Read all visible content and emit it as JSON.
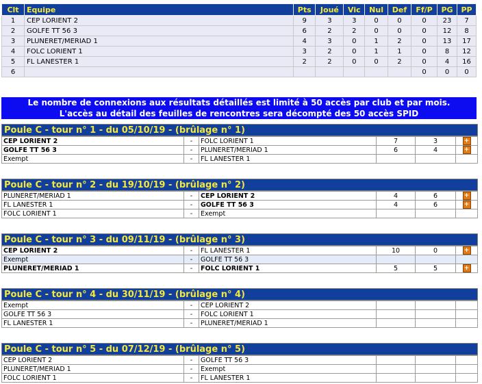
{
  "standings": {
    "headers": [
      "Clt",
      "Equipe",
      "Pts",
      "Joué",
      "Vic",
      "Nul",
      "Def",
      "Ff/P",
      "PG",
      "PP"
    ],
    "rows": [
      [
        "1",
        "CEP LORIENT 2",
        "9",
        "3",
        "3",
        "0",
        "0",
        "0",
        "23",
        "7"
      ],
      [
        "2",
        "GOLFE TT 56 3",
        "6",
        "2",
        "2",
        "0",
        "0",
        "0",
        "12",
        "8"
      ],
      [
        "3",
        "PLUNERET/MERIAD 1",
        "4",
        "3",
        "0",
        "1",
        "2",
        "0",
        "13",
        "17"
      ],
      [
        "4",
        "FOLC LORIENT 1",
        "3",
        "2",
        "0",
        "1",
        "1",
        "0",
        "8",
        "12"
      ],
      [
        "5",
        "FL LANESTER 1",
        "2",
        "2",
        "0",
        "0",
        "2",
        "0",
        "4",
        "16"
      ],
      [
        "6",
        "",
        "",
        "",
        "",
        "",
        "",
        "0",
        "0",
        "0"
      ]
    ]
  },
  "notice": {
    "line1": "Le nombre de connexions aux résultats détaillés est limité à 50 accès par club et par mois.",
    "line2": "L'accès au détail des feuilles de rencontres sera décompté des 50 accès SPID"
  },
  "rounds": [
    {
      "title": "Poule C - tour n° 1 - du 05/10/19 - (brûlage n° 1)",
      "matches": [
        {
          "a": "CEP LORIENT 2",
          "a_bold": true,
          "sep": "-",
          "b": "FOLC LORIENT 1",
          "b_bold": false,
          "sa": "7",
          "sb": "3",
          "detail": true,
          "hl": false
        },
        {
          "a": "GOLFE TT 56 3",
          "a_bold": true,
          "sep": "-",
          "b": "PLUNERET/MERIAD 1",
          "b_bold": false,
          "sa": "6",
          "sb": "4",
          "detail": true,
          "hl": false
        },
        {
          "a": "Exempt",
          "a_bold": false,
          "sep": "-",
          "b": "FL LANESTER 1",
          "b_bold": false,
          "sa": "",
          "sb": "",
          "detail": false,
          "hl": false
        }
      ]
    },
    {
      "title": "Poule C - tour n° 2 - du 19/10/19 - (brûlage n° 2)",
      "matches": [
        {
          "a": "PLUNERET/MERIAD 1",
          "a_bold": false,
          "sep": "-",
          "b": "CEP LORIENT 2",
          "b_bold": true,
          "sa": "4",
          "sb": "6",
          "detail": true,
          "hl": false
        },
        {
          "a": "FL LANESTER 1",
          "a_bold": false,
          "sep": "-",
          "b": "GOLFE TT 56 3",
          "b_bold": true,
          "sa": "4",
          "sb": "6",
          "detail": true,
          "hl": false
        },
        {
          "a": "FOLC LORIENT 1",
          "a_bold": false,
          "sep": "-",
          "b": "Exempt",
          "b_bold": false,
          "sa": "",
          "sb": "",
          "detail": false,
          "hl": false
        }
      ]
    },
    {
      "title": "Poule C - tour n° 3 - du 09/11/19 - (brûlage n° 3)",
      "matches": [
        {
          "a": "CEP LORIENT 2",
          "a_bold": true,
          "sep": "-",
          "b": "FL LANESTER 1",
          "b_bold": false,
          "sa": "10",
          "sb": "0",
          "detail": true,
          "hl": false
        },
        {
          "a": "Exempt",
          "a_bold": false,
          "sep": "-",
          "b": "GOLFE TT 56 3",
          "b_bold": false,
          "sa": "",
          "sb": "",
          "detail": false,
          "hl": true
        },
        {
          "a": "PLUNERET/MERIAD 1",
          "a_bold": true,
          "sep": "-",
          "b": "FOLC LORIENT 1",
          "b_bold": true,
          "sa": "5",
          "sb": "5",
          "detail": true,
          "hl": false
        }
      ]
    },
    {
      "title": "Poule C - tour n° 4 - du 30/11/19 - (brûlage n° 4)",
      "matches": [
        {
          "a": "Exempt",
          "a_bold": false,
          "sep": "-",
          "b": "CEP LORIENT 2",
          "b_bold": false,
          "sa": "",
          "sb": "",
          "detail": false,
          "hl": false
        },
        {
          "a": "GOLFE TT 56 3",
          "a_bold": false,
          "sep": "-",
          "b": "FOLC LORIENT 1",
          "b_bold": false,
          "sa": "",
          "sb": "",
          "detail": false,
          "hl": false
        },
        {
          "a": "FL LANESTER 1",
          "a_bold": false,
          "sep": "-",
          "b": "PLUNERET/MERIAD 1",
          "b_bold": false,
          "sa": "",
          "sb": "",
          "detail": false,
          "hl": false
        }
      ]
    },
    {
      "title": "Poule C - tour n° 5 - du 07/12/19 - (brûlage n° 5)",
      "matches": [
        {
          "a": "CEP LORIENT 2",
          "a_bold": false,
          "sep": "-",
          "b": "GOLFE TT 56 3",
          "b_bold": false,
          "sa": "",
          "sb": "",
          "detail": false,
          "hl": false
        },
        {
          "a": "PLUNERET/MERIAD 1",
          "a_bold": false,
          "sep": "-",
          "b": "Exempt",
          "b_bold": false,
          "sa": "",
          "sb": "",
          "detail": false,
          "hl": false
        },
        {
          "a": "FOLC LORIENT 1",
          "a_bold": false,
          "sep": "-",
          "b": "FL LANESTER 1",
          "b_bold": false,
          "sa": "",
          "sb": "",
          "detail": false,
          "hl": false
        }
      ]
    }
  ],
  "icons": {
    "detail": "plus-icon",
    "detail_glyph": "+"
  },
  "colors": {
    "header_bg": "#123f9c",
    "header_text": "#f6e83a",
    "notice_bg": "#0d0cf0",
    "row_bg": "#eaeaf7",
    "detail_icon": "#e07b16"
  }
}
